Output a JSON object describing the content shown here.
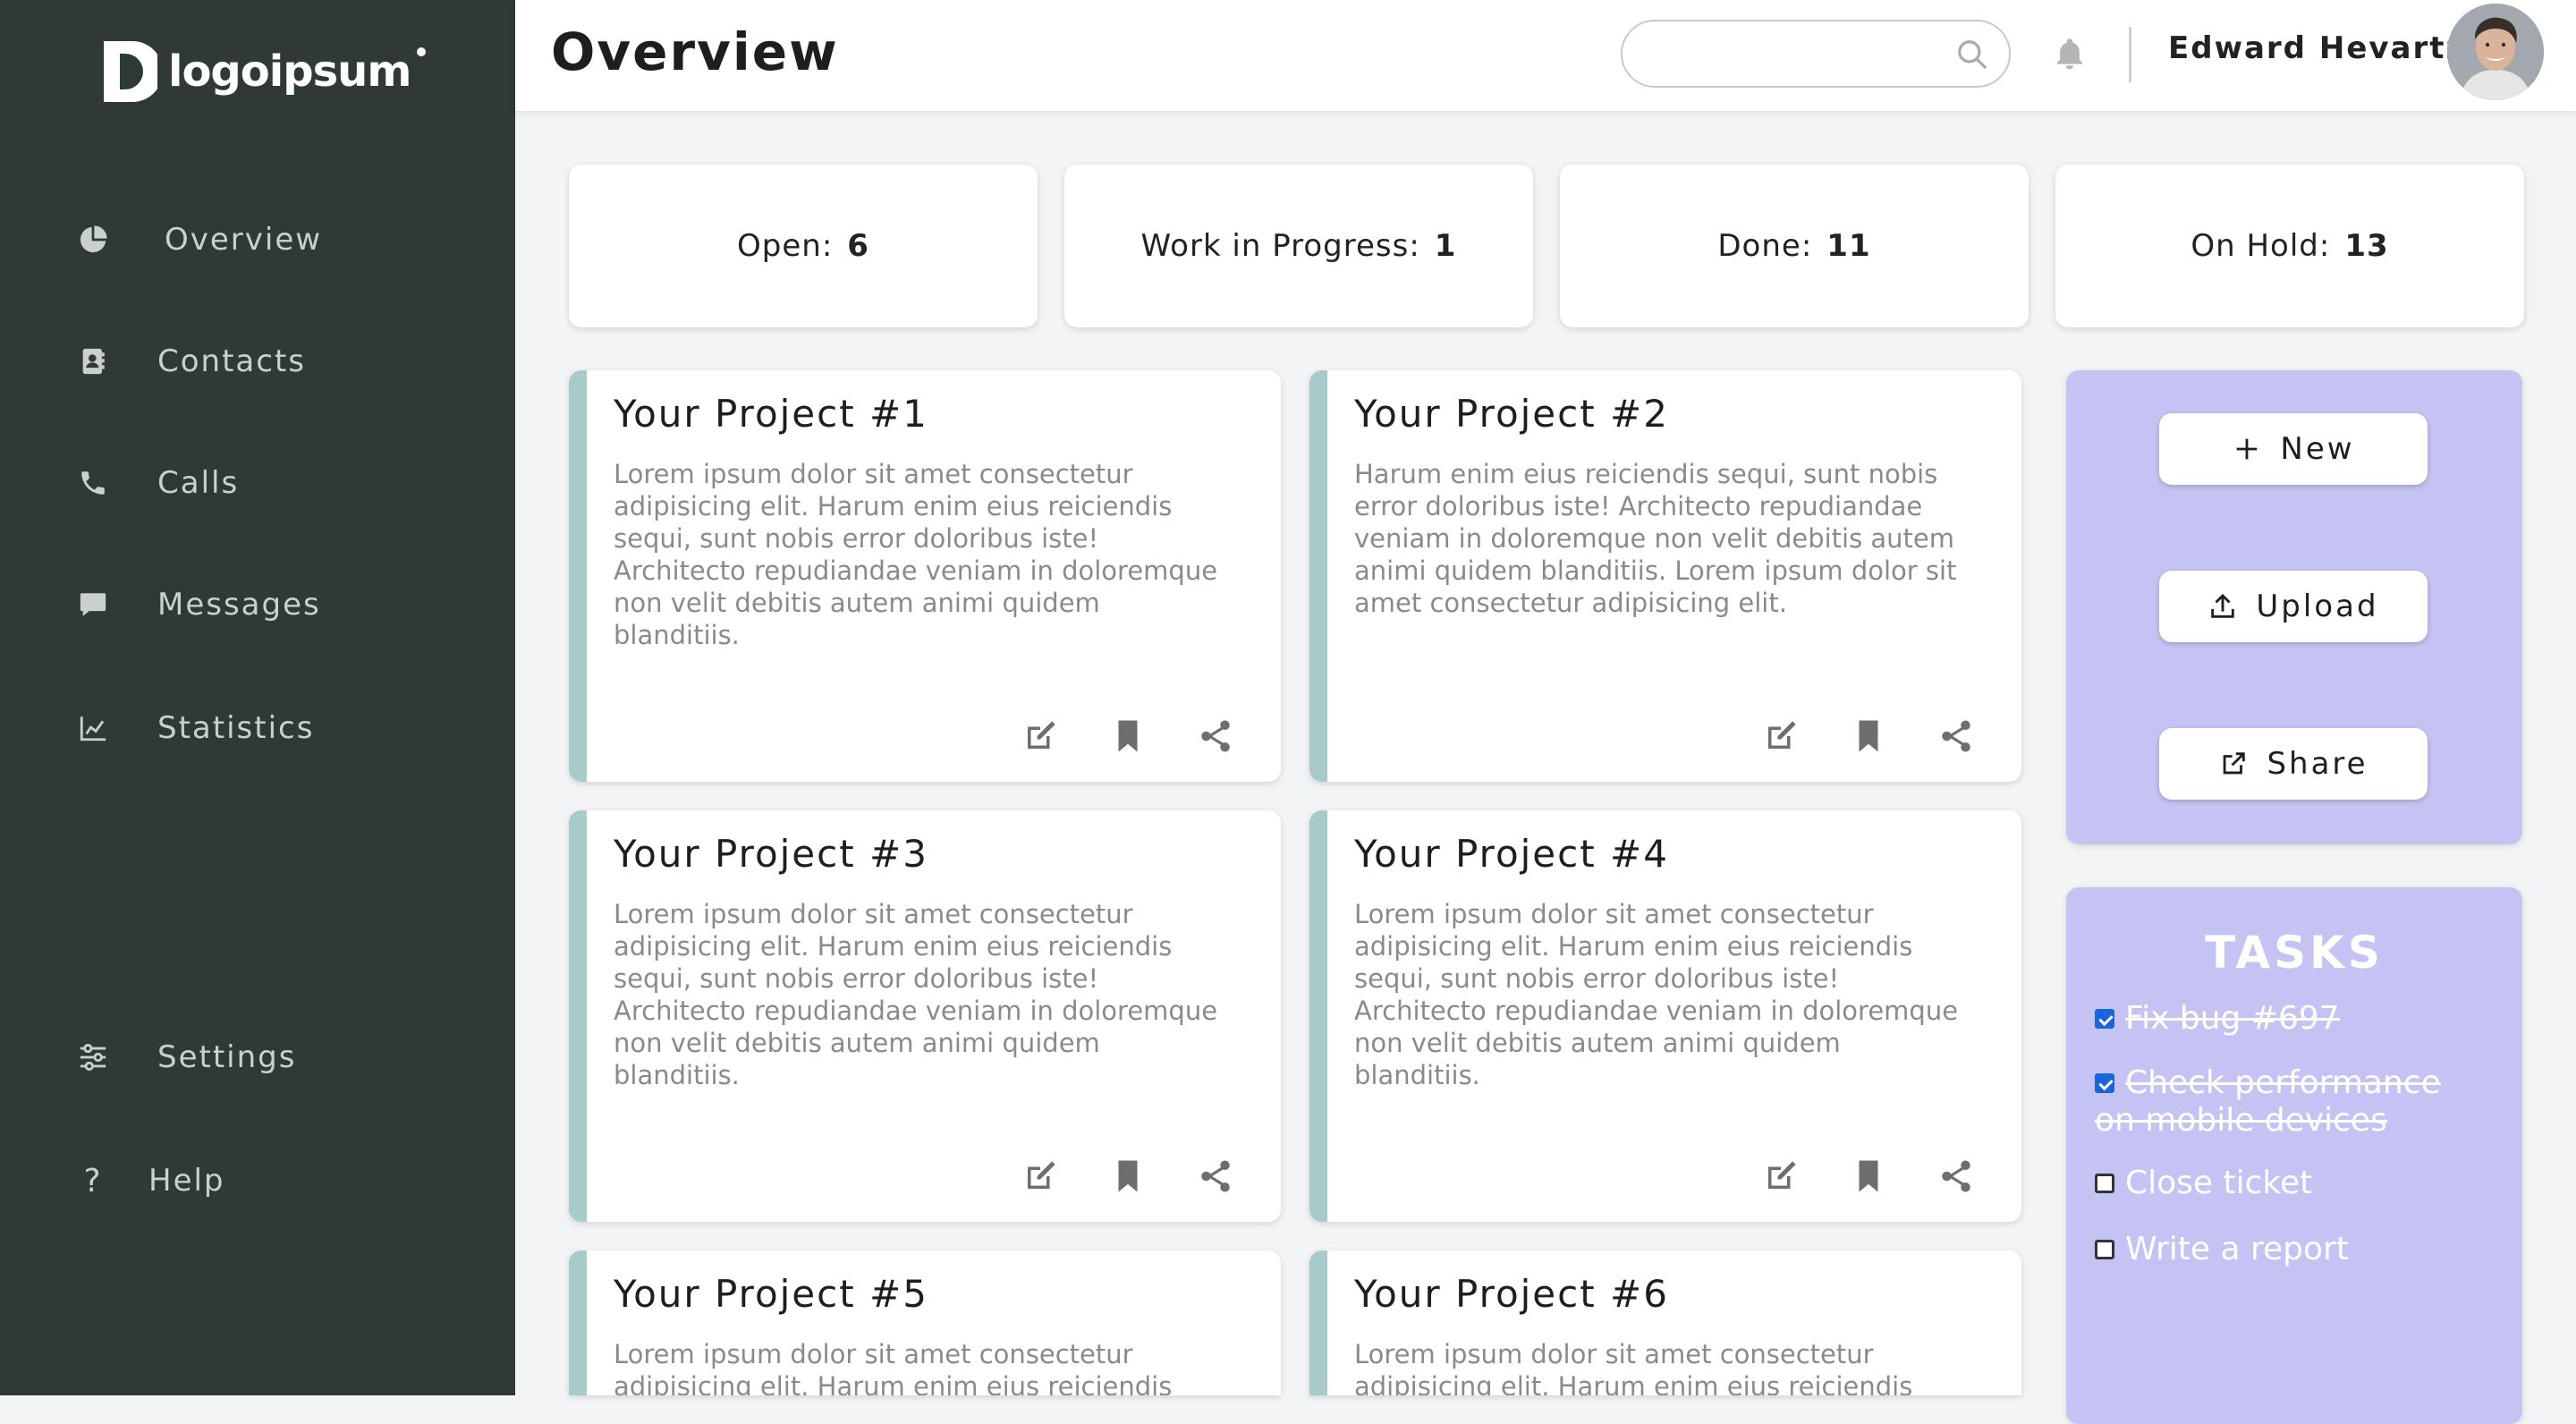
{
  "brand": {
    "logo_text": "logoipsum"
  },
  "sidebar": {
    "items": [
      {
        "label": "Overview",
        "icon": "pie-chart-icon"
      },
      {
        "label": "Contacts",
        "icon": "address-book-icon"
      },
      {
        "label": "Calls",
        "icon": "phone-icon"
      },
      {
        "label": "Messages",
        "icon": "message-icon"
      },
      {
        "label": "Statistics",
        "icon": "line-chart-icon"
      },
      {
        "label": "Settings",
        "icon": "sliders-icon"
      },
      {
        "label": "Help",
        "icon": "question-icon"
      }
    ]
  },
  "header": {
    "title": "Overview",
    "search_placeholder": "",
    "username": "Edward Hevartz"
  },
  "stats": [
    {
      "label": "Open:",
      "value": "6"
    },
    {
      "label": "Work in Progress:",
      "value": "1"
    },
    {
      "label": "Done:",
      "value": "11"
    },
    {
      "label": "On Hold:",
      "value": "13"
    }
  ],
  "projects": [
    {
      "title": "Your Project #1",
      "desc": "Lorem ipsum dolor sit amet consectetur adipisicing elit. Harum enim eius reiciendis sequi, sunt nobis error doloribus iste! Architecto repudiandae veniam in doloremque non velit debitis autem animi quidem blanditiis."
    },
    {
      "title": "Your Project #2",
      "desc": "Harum enim eius reiciendis sequi, sunt nobis error doloribus iste! Architecto repudiandae veniam in doloremque non velit debitis autem animi quidem blanditiis. Lorem ipsum dolor sit amet consectetur adipisicing elit."
    },
    {
      "title": "Your Project #3",
      "desc": "Lorem ipsum dolor sit amet consectetur adipisicing elit. Harum enim eius reiciendis sequi, sunt nobis error doloribus iste! Architecto repudiandae veniam in doloremque non velit debitis autem animi quidem blanditiis."
    },
    {
      "title": "Your Project #4",
      "desc": "Lorem ipsum dolor sit amet consectetur adipisicing elit. Harum enim eius reiciendis sequi, sunt nobis error doloribus iste! Architecto repudiandae veniam in doloremque non velit debitis autem animi quidem blanditiis."
    },
    {
      "title": "Your Project #5",
      "desc": "Lorem ipsum dolor sit amet consectetur adipisicing elit. Harum enim eius reiciendis"
    },
    {
      "title": "Your Project #6",
      "desc": "Lorem ipsum dolor sit amet consectetur adipisicing elit. Harum enim eius reiciendis"
    }
  ],
  "actions": {
    "new_label": "New",
    "upload_label": "Upload",
    "share_label": "Share"
  },
  "tasks": {
    "title": "TASKS",
    "items": [
      {
        "label": "Fix bug #697",
        "done": true
      },
      {
        "label": "Check performance on mobile devices",
        "done": true
      },
      {
        "label": "Close ticket",
        "done": false
      },
      {
        "label": "Write a report",
        "done": false
      }
    ]
  },
  "colors": {
    "sidebar_bg": "#2f3a38",
    "accent_bar": "#a8cac8",
    "panel_bg": "#c5c3f3",
    "checkbox_checked": "#1a66d9"
  }
}
